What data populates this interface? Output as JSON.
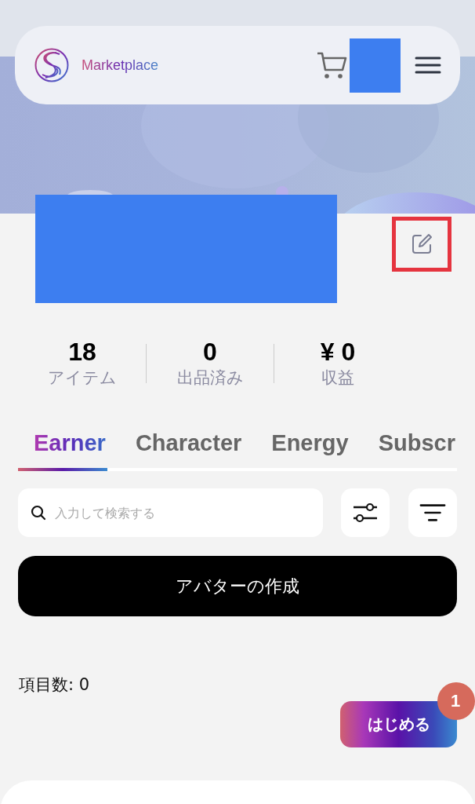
{
  "header": {
    "brand": "Marketplace"
  },
  "stats": [
    {
      "value": "18",
      "label": "アイテム"
    },
    {
      "value": "0",
      "label": "出品済み"
    },
    {
      "value": "¥ 0",
      "label": "収益"
    }
  ],
  "tabs": [
    {
      "label": "Earner",
      "selected": true
    },
    {
      "label": "Character",
      "selected": false
    },
    {
      "label": "Energy",
      "selected": false
    },
    {
      "label": "Subscr",
      "selected": false
    }
  ],
  "search": {
    "placeholder": "入力して検索する"
  },
  "create_button": "アバターの作成",
  "item_count": "項目数: 0",
  "start_button": {
    "label": "はじめる",
    "badge": "1"
  }
}
